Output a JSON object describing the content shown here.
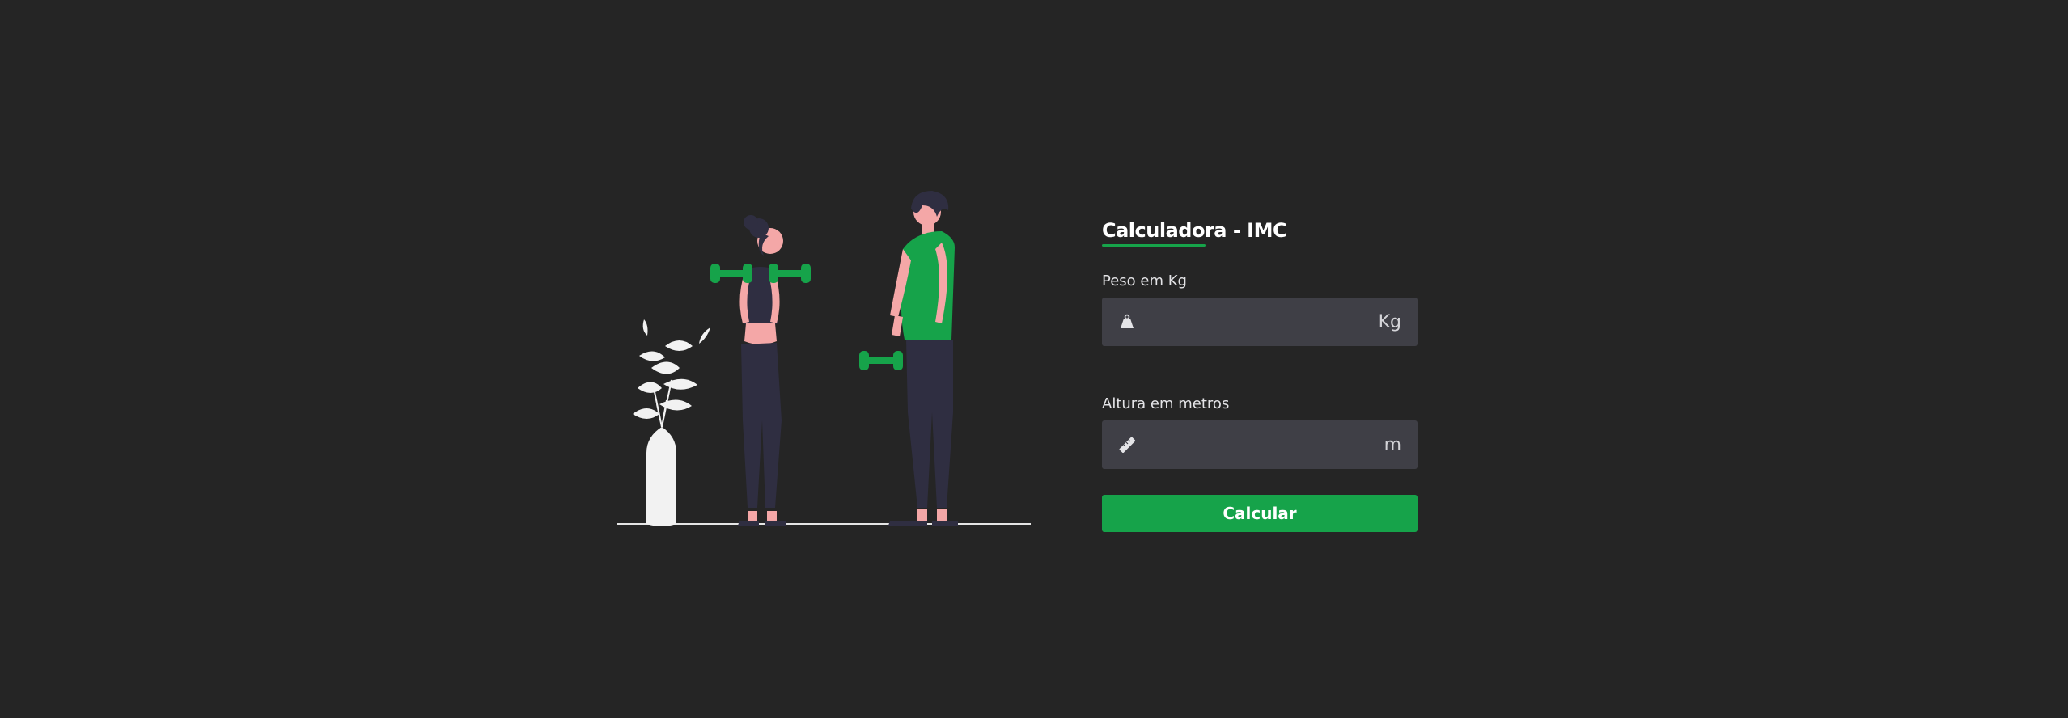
{
  "form": {
    "title": "Calculadora - IMC",
    "weight": {
      "label": "Peso em Kg",
      "value": "",
      "placeholder": "",
      "unit": "Kg",
      "icon": "weight-icon"
    },
    "height": {
      "label": "Altura em metros",
      "value": "",
      "placeholder": "",
      "unit": "m",
      "icon": "ruler-icon"
    },
    "button_label": "Calcular"
  },
  "colors": {
    "background": "#252525",
    "accent": "#16a34a",
    "input_bg": "#3f3f46",
    "text": "#ffffff"
  }
}
